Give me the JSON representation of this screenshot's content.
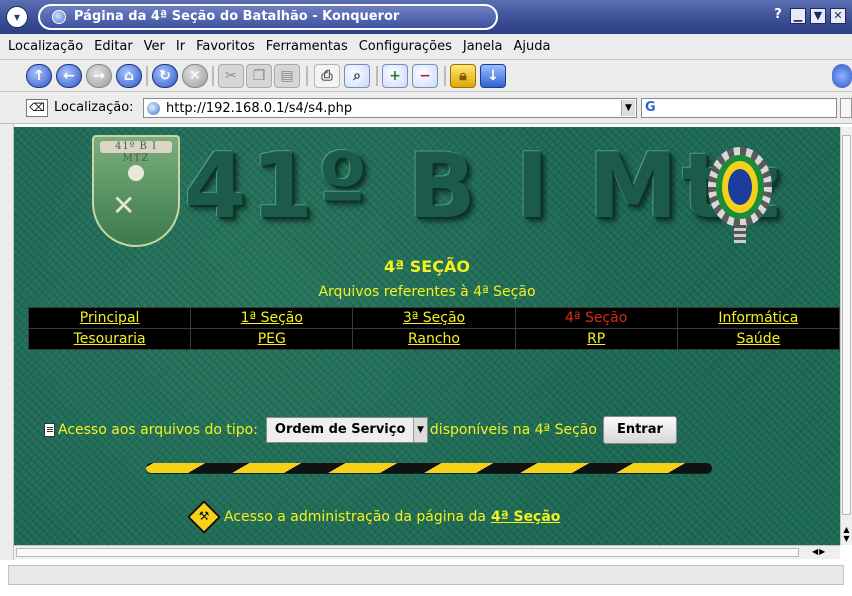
{
  "window": {
    "title": "Página da 4ª Seção do Batalhão - Konqueror",
    "help_glyph": "?",
    "minimize_glyph": "▁",
    "maximize_glyph": "▼",
    "close_glyph": "✕"
  },
  "menubar": {
    "items": [
      "Localização",
      "Editar",
      "Ver",
      "Ir",
      "Favoritos",
      "Ferramentas",
      "Configurações",
      "Janela",
      "Ajuda"
    ]
  },
  "toolbar": {
    "icons": [
      "up-icon",
      "back-icon",
      "forward-icon",
      "home-icon",
      "reload-icon",
      "stop-icon",
      "cut-icon",
      "copy-icon",
      "paste-icon",
      "print-icon",
      "print-preview-icon",
      "zoom-in-icon",
      "zoom-out-icon",
      "security-lock-icon",
      "download-icon"
    ]
  },
  "location": {
    "label": "Localização:",
    "url": "http://192.168.0.1/s4/s4.php",
    "search_glyph": "G"
  },
  "page": {
    "banner_text": "41º B I Mtz",
    "crest_label": "41º B I MTZ",
    "section_title": "4ª SEÇÃO",
    "section_subtitle": "Arquivos referentes à 4ª Seção",
    "nav_row1": [
      "Principal",
      "1ª Seção",
      "3ª Seção",
      "4ª Seção",
      "Informática"
    ],
    "nav_row2": [
      "Tesouraria",
      "PEG",
      "Rancho",
      "RP",
      "Saúde"
    ],
    "active_nav": "4ª Seção",
    "access_prefix": "Acesso aos arquivos do tipo:",
    "select_value": "Ordem de Serviço",
    "access_suffix": "disponíveis na 4ª Seção",
    "enter_button": "Entrar",
    "admin_text": "Acesso a administração da página da",
    "admin_link": "4ª Seção"
  },
  "colors": {
    "page_background": "#1d6a55",
    "link_yellow": "#f5f21d",
    "active_red": "#e0271a",
    "titlebar_blue": "#3b4d93"
  }
}
